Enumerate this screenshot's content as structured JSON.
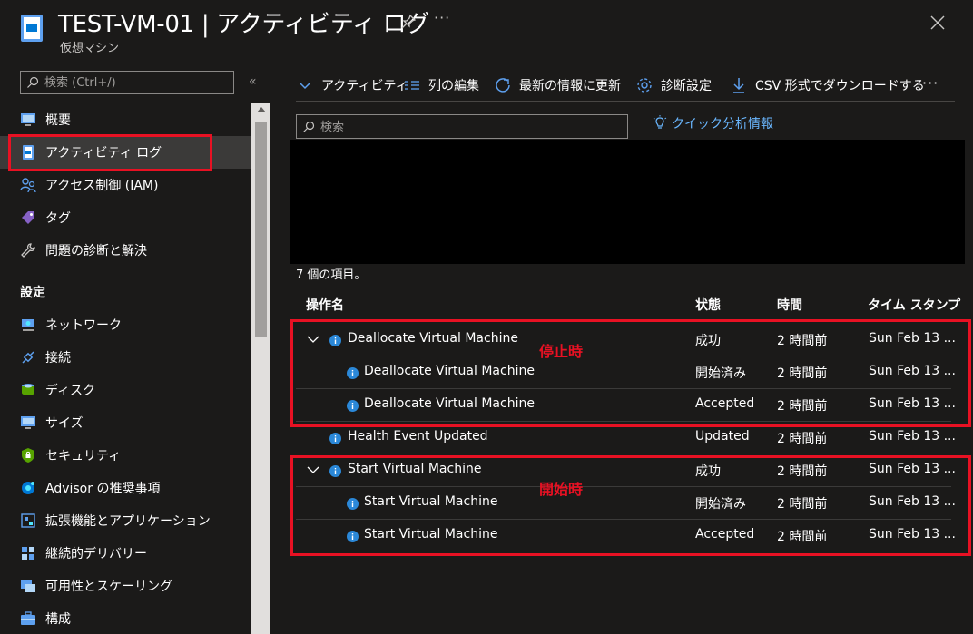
{
  "header": {
    "title": "TEST-VM-01 | アクティビティ ログ",
    "subtitle": "仮想マシン",
    "more": "···"
  },
  "sidebar": {
    "search_placeholder": "検索 (Ctrl+/)",
    "collapse": "«",
    "items": [
      {
        "label": "概要",
        "icon": "overview-icon"
      },
      {
        "label": "アクティビティ ログ",
        "icon": "activity-log-icon",
        "active": true
      },
      {
        "label": "アクセス制御 (IAM)",
        "icon": "iam-icon"
      },
      {
        "label": "タグ",
        "icon": "tag-icon"
      },
      {
        "label": "問題の診断と解決",
        "icon": "wrench-icon"
      }
    ],
    "section_settings": "設定",
    "settings_items": [
      {
        "label": "ネットワーク",
        "icon": "network-icon"
      },
      {
        "label": "接続",
        "icon": "connect-icon"
      },
      {
        "label": "ディスク",
        "icon": "disk-icon"
      },
      {
        "label": "サイズ",
        "icon": "size-icon"
      },
      {
        "label": "セキュリティ",
        "icon": "security-icon"
      },
      {
        "label": "Advisor の推奨事項",
        "icon": "advisor-icon"
      },
      {
        "label": "拡張機能とアプリケーション",
        "icon": "extensions-icon"
      },
      {
        "label": "継続的デリバリー",
        "icon": "delivery-icon"
      },
      {
        "label": "可用性とスケーリング",
        "icon": "availability-icon"
      },
      {
        "label": "構成",
        "icon": "configuration-icon"
      }
    ]
  },
  "toolbar": {
    "activity": "アクティビティ",
    "edit_columns": "列の編集",
    "refresh": "最新の情報に更新",
    "diagnostic": "診断設定",
    "csv": "CSV 形式でダウンロードする",
    "more": "···"
  },
  "main": {
    "search_placeholder": "検索",
    "insights": "クイック分析情報",
    "count": "7 個の項目。"
  },
  "table": {
    "headers": [
      "操作名",
      "状態",
      "時間",
      "タイム スタンプ"
    ],
    "rows": [
      {
        "name": "Deallocate Virtual Machine",
        "status": "成功",
        "time": "2 時間前",
        "timestamp": "Sun Feb 13 ...",
        "expanded": true,
        "child": false
      },
      {
        "name": "Deallocate Virtual Machine",
        "status": "開始済み",
        "time": "2 時間前",
        "timestamp": "Sun Feb 13 ...",
        "child": true
      },
      {
        "name": "Deallocate Virtual Machine",
        "status": "Accepted",
        "time": "2 時間前",
        "timestamp": "Sun Feb 13 ...",
        "child": true
      },
      {
        "name": "Health Event Updated",
        "status": "Updated",
        "time": "2 時間前",
        "timestamp": "Sun Feb 13 ...",
        "child": false
      },
      {
        "name": "Start Virtual Machine",
        "status": "成功",
        "time": "2 時間前",
        "timestamp": "Sun Feb 13 ...",
        "expanded": true,
        "child": false
      },
      {
        "name": "Start Virtual Machine",
        "status": "開始済み",
        "time": "2 時間前",
        "timestamp": "Sun Feb 13 ...",
        "child": true
      },
      {
        "name": "Start Virtual Machine",
        "status": "Accepted",
        "time": "2 時間前",
        "timestamp": "Sun Feb 13 ...",
        "child": true
      }
    ]
  },
  "annotations": {
    "stop": "停止時",
    "start": "開始時"
  },
  "colors": {
    "accent": "#0078d4",
    "link": "#6ab7ff",
    "annotation": "#e81123"
  }
}
